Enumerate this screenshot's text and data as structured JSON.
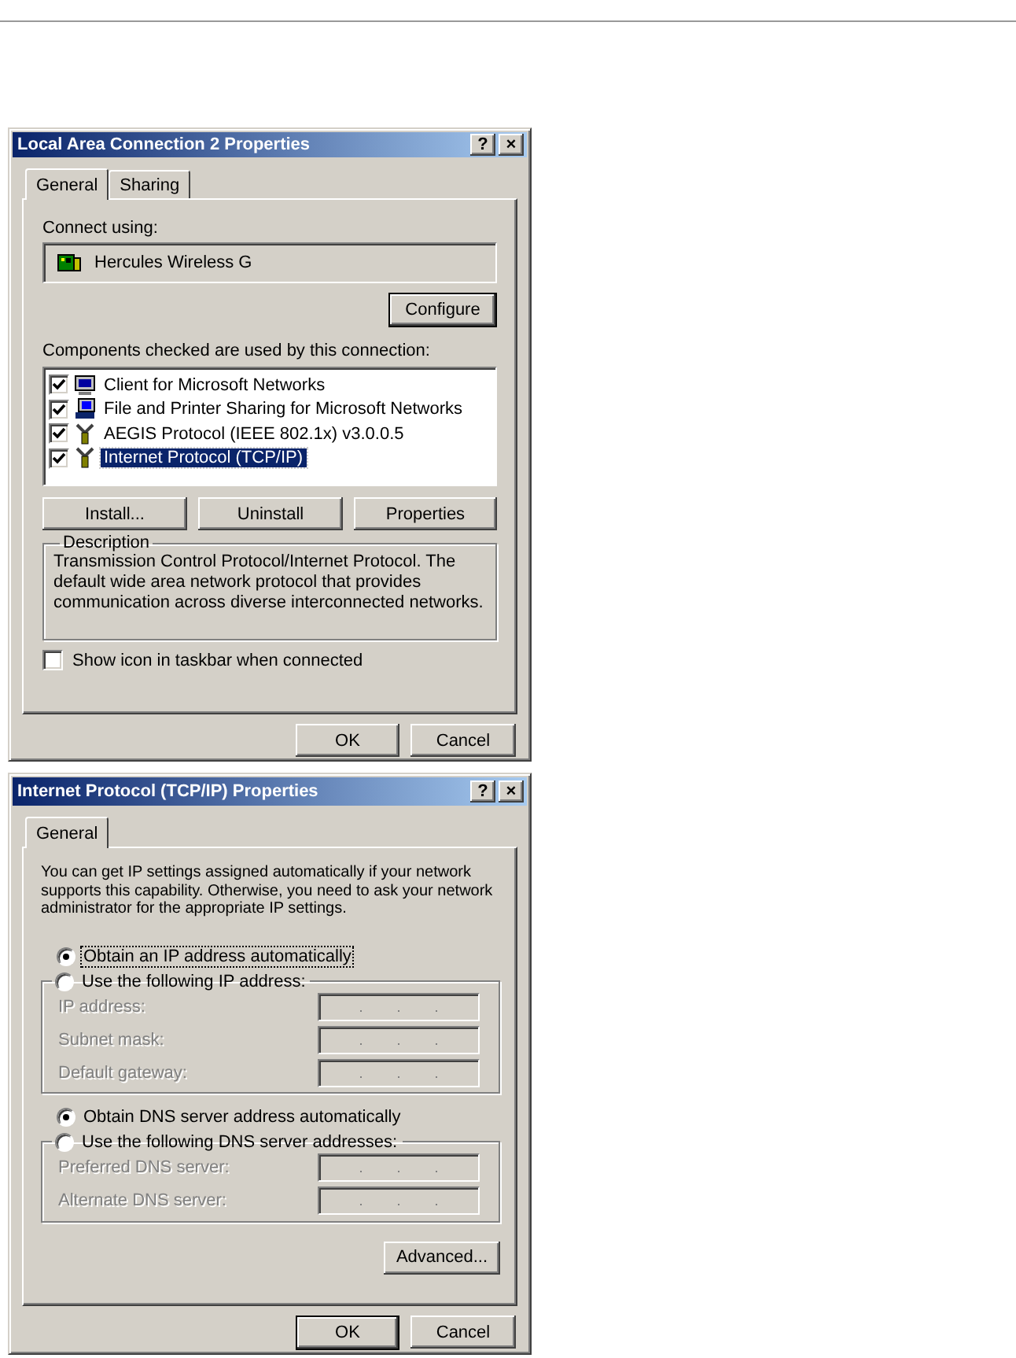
{
  "connection_dialog": {
    "title": "Local Area Connection 2 Properties",
    "title_buttons": [
      "?",
      "×"
    ],
    "tabs": [
      {
        "label": "General",
        "selected": true
      },
      {
        "label": "Sharing",
        "selected": false
      }
    ],
    "connect_using_label": "Connect using:",
    "adapter": "Hercules Wireless G",
    "configure_button": {
      "label": "Configure",
      "default": true
    },
    "components_label": "Components checked are used by this connection:",
    "components": [
      {
        "name": "Client for Microsoft Networks",
        "kind": "client",
        "checked": true,
        "selected": false
      },
      {
        "name": "File and Printer Sharing for Microsoft Networks",
        "kind": "service",
        "checked": true,
        "selected": false
      },
      {
        "name": "AEGIS Protocol (IEEE 802.1x) v3.0.0.5",
        "kind": "protocol",
        "checked": true,
        "selected": false
      },
      {
        "name": "Internet Protocol (TCP/IP)",
        "kind": "protocol",
        "checked": true,
        "selected": true
      }
    ],
    "component_buttons": [
      "Install...",
      "Uninstall",
      "Properties"
    ],
    "description": {
      "legend": "Description",
      "text": "Transmission Control Protocol/Internet Protocol. The default wide area network protocol that provides communication across diverse interconnected networks."
    },
    "show_icon": {
      "label": "Show icon in taskbar when connected",
      "checked": false
    },
    "footer_buttons": [
      {
        "label": "OK",
        "default": false
      },
      {
        "label": "Cancel",
        "default": false
      }
    ]
  },
  "tcpip_dialog": {
    "title": "Internet Protocol (TCP/IP) Properties",
    "title_buttons": [
      "?",
      "×"
    ],
    "tabs": [
      {
        "label": "General",
        "selected": true
      }
    ],
    "intro": "You can get IP settings assigned automatically if your network supports this capability. Otherwise, you need to ask your network administrator for the appropriate IP settings.",
    "ip_options": [
      {
        "label": "Obtain an IP address automatically",
        "selected": true,
        "focused": true
      },
      {
        "label": "Use the following IP address:",
        "selected": false,
        "focused": false
      }
    ],
    "ip_fields": [
      {
        "label": "IP address:",
        "disabled": true
      },
      {
        "label": "Subnet mask:",
        "disabled": true
      },
      {
        "label": "Default gateway:",
        "disabled": true
      }
    ],
    "dns_options": [
      {
        "label": "Obtain DNS server address automatically",
        "selected": true,
        "focused": false
      },
      {
        "label": "Use the following DNS server addresses:",
        "selected": false,
        "focused": false
      }
    ],
    "dns_fields": [
      {
        "label": "Preferred DNS server:",
        "disabled": true
      },
      {
        "label": "Alternate DNS server:",
        "disabled": true
      }
    ],
    "advanced_button": {
      "label": "Advanced...",
      "default": false
    },
    "footer_buttons": [
      {
        "label": "OK",
        "default": true
      },
      {
        "label": "Cancel",
        "default": false
      }
    ]
  }
}
